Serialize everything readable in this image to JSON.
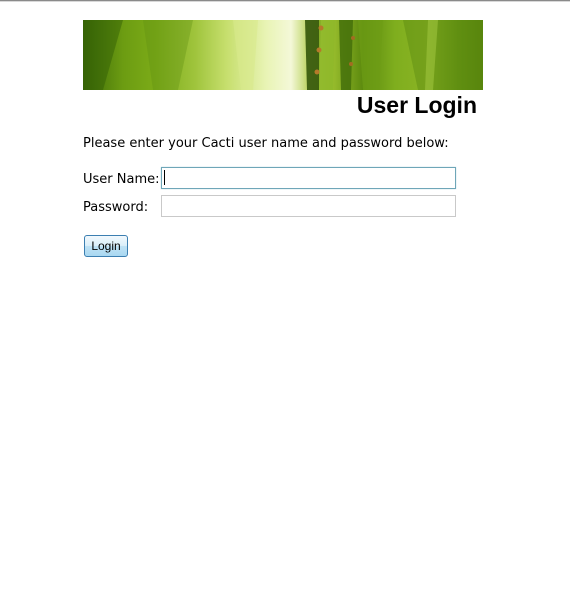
{
  "page": {
    "title": "User Login",
    "intro": "Please enter your Cacti user name and password below:"
  },
  "form": {
    "username_label": "User Name:",
    "username_value": "",
    "password_label": "Password:",
    "password_value": "",
    "login_label": "Login"
  },
  "colors": {
    "banner_green": "#7cab18",
    "focus_border": "#6fa6b8",
    "button_border": "#3c7fb1"
  }
}
